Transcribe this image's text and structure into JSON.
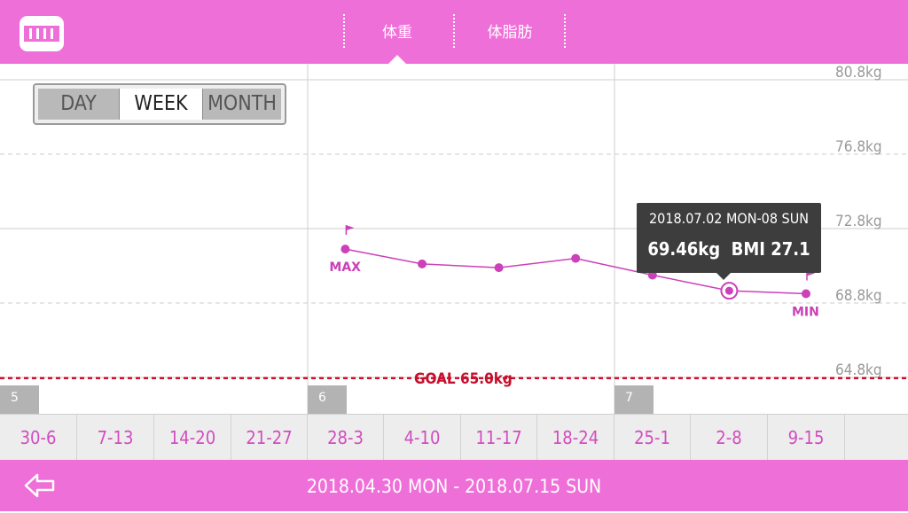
{
  "header": {
    "tabs": [
      {
        "label": "体重",
        "selected": true
      },
      {
        "label": "体脂肪",
        "selected": false
      }
    ],
    "logo_icon": "scale-icon"
  },
  "period_selector": {
    "day": "DAY",
    "week": "WEEK",
    "month": "MONTH",
    "selected": "WEEK"
  },
  "chart_data": {
    "type": "line",
    "categories": [
      "30-6",
      "7-13",
      "14-20",
      "21-27",
      "28-3",
      "4-10",
      "11-17",
      "18-24",
      "25-1",
      "2-8",
      "9-15"
    ],
    "values": [
      null,
      null,
      null,
      null,
      71.7,
      70.9,
      70.7,
      71.2,
      70.3,
      69.46,
      69.3
    ],
    "y_ticks": [
      "80.8kg",
      "76.8kg",
      "72.8kg",
      "68.8kg",
      "64.8kg"
    ],
    "ylim": [
      64.8,
      80.8
    ],
    "goal_label": "GOAL 65.0kg",
    "goal_value": 65.0,
    "max_label": "MAX",
    "min_label": "MIN",
    "month_markers": [
      "5",
      "6",
      "7"
    ],
    "selected_index": 9,
    "line_color": "#cc40b8",
    "goal_color": "#c8102e"
  },
  "tooltip": {
    "date": "2018.07.02 MON-08 SUN",
    "value": "69.46kg  BMI 27.1"
  },
  "footer": {
    "range": "2018.04.30 MON - 2018.07.15 SUN",
    "back_icon": "back-arrow-icon"
  },
  "colors": {
    "accent": "#ef6fd8",
    "week_text": "#d24cbf"
  }
}
